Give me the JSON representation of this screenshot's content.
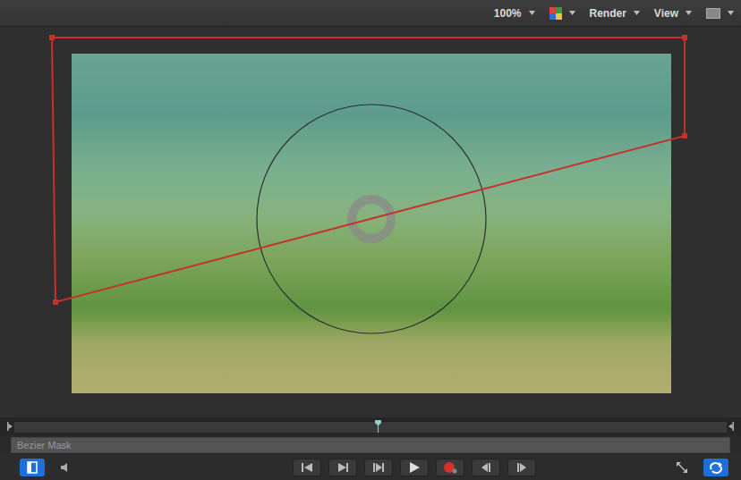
{
  "toolbar": {
    "zoom": "100%",
    "menus": [
      {
        "label": "Render"
      },
      {
        "label": "View"
      }
    ]
  },
  "timeline": {
    "playhead": 0.51,
    "track": {
      "label": "Bezier Mask",
      "enabled": false
    }
  },
  "controls": {
    "left": [
      {
        "kind": "layers",
        "on": true
      },
      {
        "kind": "mute",
        "on": false
      }
    ],
    "transport": [
      {
        "kind": "to-start",
        "on": false
      },
      {
        "kind": "play-from",
        "on": false
      },
      {
        "kind": "to-end",
        "on": false
      },
      {
        "kind": "play",
        "on": false
      },
      {
        "kind": "record",
        "on": false
      },
      {
        "kind": "prev-frame",
        "on": false
      },
      {
        "kind": "next-frame",
        "on": false
      }
    ],
    "right": [
      {
        "kind": "fullscreen",
        "on": false
      },
      {
        "kind": "loop",
        "on": true
      }
    ]
  }
}
